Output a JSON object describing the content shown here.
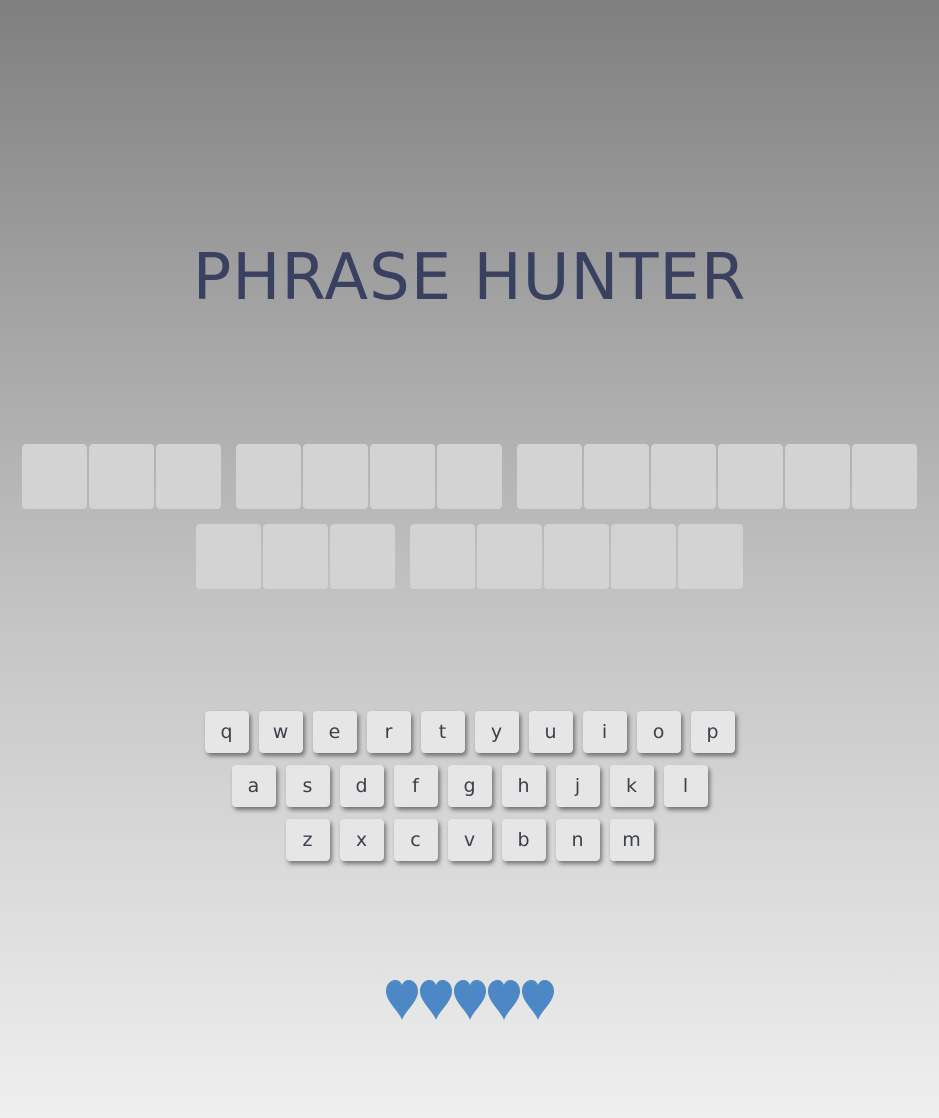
{
  "title": "PHRASE HUNTER",
  "phrase": {
    "lines": [
      {
        "words": [
          {
            "letters": 3
          },
          {
            "letters": 4
          },
          {
            "letters": 6
          }
        ]
      },
      {
        "words": [
          {
            "letters": 3
          },
          {
            "letters": 5
          }
        ]
      }
    ]
  },
  "keyboard": {
    "rows": [
      [
        "q",
        "w",
        "e",
        "r",
        "t",
        "y",
        "u",
        "i",
        "o",
        "p"
      ],
      [
        "a",
        "s",
        "d",
        "f",
        "g",
        "h",
        "j",
        "k",
        "l"
      ],
      [
        "z",
        "x",
        "c",
        "v",
        "b",
        "n",
        "m"
      ]
    ]
  },
  "lives": {
    "remaining": 5,
    "total": 5,
    "icon": "heart-icon",
    "color": "#4b88c5"
  },
  "colors": {
    "title": "#3a4160",
    "tile": "#d3d3d3",
    "key": "#e6e6e6"
  }
}
